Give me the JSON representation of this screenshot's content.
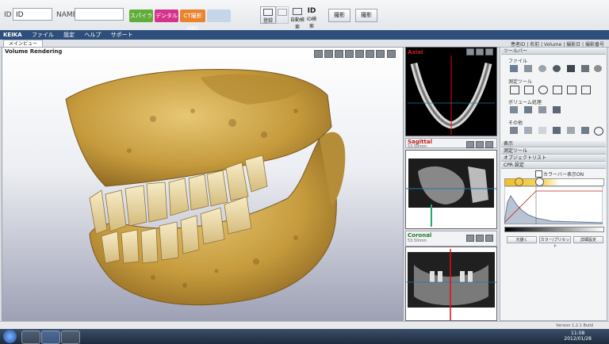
{
  "topbar": {
    "id_label": "ID",
    "id_value": "ID",
    "name_label": "NAME",
    "name_value": "",
    "btn_green": "スパイラ",
    "btn_pink": "デンタル",
    "btn_orange": "CT撮影ABS",
    "btn_light": "",
    "tool1": "登録",
    "tool2": "",
    "tool3": "自動検索",
    "tool4_top": "ID",
    "tool4": "ID検索",
    "btn_register": "撮影",
    "btn_capture": "撮影"
  },
  "appbar": {
    "title": "KEIKA",
    "menu": [
      "ファイル",
      "設定",
      "ヘルプ",
      "サポート"
    ]
  },
  "tabs": {
    "doc_tab": "メインビュー",
    "status": "患者ID | 名前 | Volume | 撮影日 | 撮影番号"
  },
  "view3d": {
    "title": "Volume Rendering"
  },
  "slices": {
    "axial": {
      "title": "Axial",
      "sub": ""
    },
    "sagittal": {
      "title": "Sagittal",
      "sub": "53.50mm"
    },
    "coronal": {
      "title": "Coronal",
      "sub": "53.50mm"
    }
  },
  "rpanel": {
    "header": "ツールバー",
    "file_label": "ファイル",
    "measure_label": "測定ツール",
    "volume_label": "ボリューム処理",
    "other_label": "その他",
    "sect_display": "表示",
    "sect_measure": "測定ツール",
    "sect_object": "オブジェクトリスト",
    "sect_cpr": "CPR 設定",
    "colorbar_label": "カラーバー表示ON",
    "btn1": "元描く",
    "btn2": "カラー/プリセット",
    "btn3": "詳細設定"
  },
  "footer": {
    "version": "Version 1.2.1 Build"
  },
  "taskbar": {
    "time": "11:08",
    "date": "2012/01/28"
  },
  "colors": {
    "bone": "#c9a24a",
    "title_blue": "#2e4f7b",
    "red_accent": "#c0201c",
    "panel_bg": "#f3f4f6"
  }
}
